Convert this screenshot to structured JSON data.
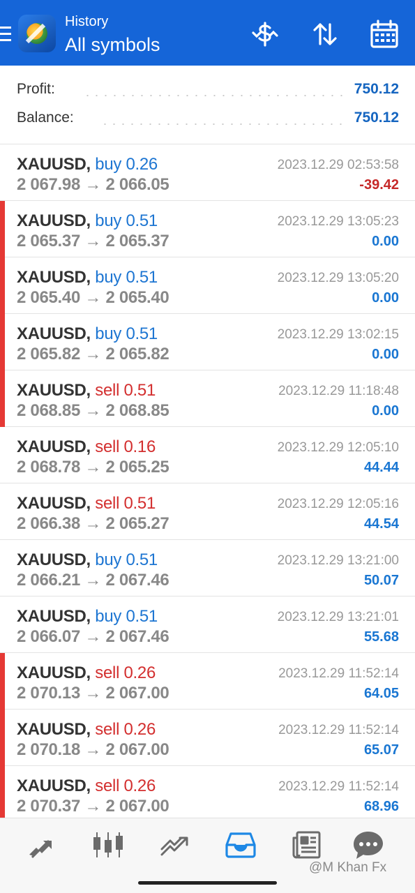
{
  "header": {
    "subtitle": "History",
    "title": "All symbols",
    "icons": [
      "menu-icon",
      "app-logo",
      "deposit-dollar-icon",
      "sort-icon",
      "calendar-icon"
    ],
    "colors": {
      "bar": "#1565d8"
    }
  },
  "summary": {
    "profit_label": "Profit:",
    "profit_value": "750.12",
    "balance_label": "Balance:",
    "balance_value": "750.12"
  },
  "deals": [
    {
      "symbol": "XAUUSD,",
      "side": "buy",
      "volume": "buy 0.26",
      "prices": "2 067.98 → 2 066.05",
      "time": "2023.12.29 02:53:58",
      "profit": "-39.42",
      "marker": false
    },
    {
      "symbol": "XAUUSD,",
      "side": "buy",
      "volume": "buy 0.51",
      "prices": "2 065.37 → 2 065.37",
      "time": "2023.12.29 13:05:23",
      "profit": "0.00",
      "marker": true
    },
    {
      "symbol": "XAUUSD,",
      "side": "buy",
      "volume": "buy 0.51",
      "prices": "2 065.40 → 2 065.40",
      "time": "2023.12.29 13:05:20",
      "profit": "0.00",
      "marker": true
    },
    {
      "symbol": "XAUUSD,",
      "side": "buy",
      "volume": "buy 0.51",
      "prices": "2 065.82 → 2 065.82",
      "time": "2023.12.29 13:02:15",
      "profit": "0.00",
      "marker": true
    },
    {
      "symbol": "XAUUSD,",
      "side": "sell",
      "volume": "sell 0.51",
      "prices": "2 068.85 → 2 068.85",
      "time": "2023.12.29 11:18:48",
      "profit": "0.00",
      "marker": true
    },
    {
      "symbol": "XAUUSD,",
      "side": "sell",
      "volume": "sell 0.16",
      "prices": "2 068.78 → 2 065.25",
      "time": "2023.12.29 12:05:10",
      "profit": "44.44",
      "marker": false
    },
    {
      "symbol": "XAUUSD,",
      "side": "sell",
      "volume": "sell 0.51",
      "prices": "2 066.38 → 2 065.27",
      "time": "2023.12.29 12:05:16",
      "profit": "44.54",
      "marker": false
    },
    {
      "symbol": "XAUUSD,",
      "side": "buy",
      "volume": "buy 0.51",
      "prices": "2 066.21 → 2 067.46",
      "time": "2023.12.29 13:21:00",
      "profit": "50.07",
      "marker": false
    },
    {
      "symbol": "XAUUSD,",
      "side": "buy",
      "volume": "buy 0.51",
      "prices": "2 066.07 → 2 067.46",
      "time": "2023.12.29 13:21:01",
      "profit": "55.68",
      "marker": false
    },
    {
      "symbol": "XAUUSD,",
      "side": "sell",
      "volume": "sell 0.26",
      "prices": "2 070.13 → 2 067.00",
      "time": "2023.12.29 11:52:14",
      "profit": "64.05",
      "marker": true
    },
    {
      "symbol": "XAUUSD,",
      "side": "sell",
      "volume": "sell 0.26",
      "prices": "2 070.18 → 2 067.00",
      "time": "2023.12.29 11:52:14",
      "profit": "65.07",
      "marker": true
    },
    {
      "symbol": "XAUUSD,",
      "side": "sell",
      "volume": "sell 0.26",
      "prices": "2 070.37 → 2 067.00",
      "time": "2023.12.29 11:52:14",
      "profit": "68.96",
      "marker": true
    }
  ],
  "bottom_nav": {
    "items": [
      "quotes-icon",
      "chart-icon",
      "trade-icon",
      "history-icon",
      "news-icon",
      "chat-icon"
    ],
    "active": "history-icon",
    "watermark": "@M Khan Fx"
  },
  "colors": {
    "accent": "#1565d8",
    "buy": "#1e76d2",
    "sell": "#d32f2f",
    "profit_positive": "#1976d2",
    "profit_negative": "#c62828",
    "marker": "#e53935"
  }
}
